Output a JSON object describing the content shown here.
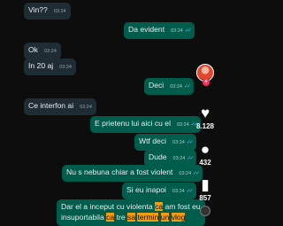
{
  "messages": [
    {
      "dir": "in",
      "text": "Vin??",
      "time": "03:24"
    },
    {
      "dir": "out",
      "text": "Da evident",
      "time": "03:24"
    },
    {
      "dir": "in",
      "text": "Ok",
      "time": "03:24"
    },
    {
      "dir": "in",
      "text": "In 20 aj",
      "time": "03:24"
    },
    {
      "dir": "out",
      "text": "Deci",
      "time": "03:24"
    },
    {
      "dir": "in",
      "text": "Ce interfon ai",
      "time": "03:24"
    },
    {
      "dir": "out",
      "text": "E prietenu lui aici cu el",
      "time": "03:24"
    },
    {
      "dir": "out",
      "text": "Wtf deci",
      "time": "03:24"
    },
    {
      "dir": "out",
      "text": "Dude",
      "time": "03:24"
    },
    {
      "dir": "out",
      "text": "Nu s nebuna chiar a fost violent",
      "time": "03:24"
    },
    {
      "dir": "out",
      "text": "Si eu inapoi",
      "time": "03:24"
    },
    {
      "dir": "out",
      "line1_parts": [
        "Dar el a inceput cu violenta ",
        "ca",
        " am fost eu"
      ],
      "line2_parts": [
        "insuportabila ",
        "ca",
        " tre ",
        "sa",
        " ",
        "termin",
        " ",
        "un",
        " ",
        "vlog"
      ]
    }
  ],
  "actions": [
    {
      "icon": "heart-icon",
      "glyph": "♥",
      "count": "8.128"
    },
    {
      "icon": "comment-icon",
      "glyph": "●",
      "count": "432"
    },
    {
      "icon": "bookmark-icon",
      "glyph": "▮",
      "count": "857"
    },
    {
      "icon": "share-icon",
      "glyph": "➦",
      "count": ""
    }
  ],
  "colors": {
    "incoming": "#202c33",
    "outgoing": "#005c4b",
    "highlight": "#f39c12",
    "check": "#53bdeb"
  }
}
